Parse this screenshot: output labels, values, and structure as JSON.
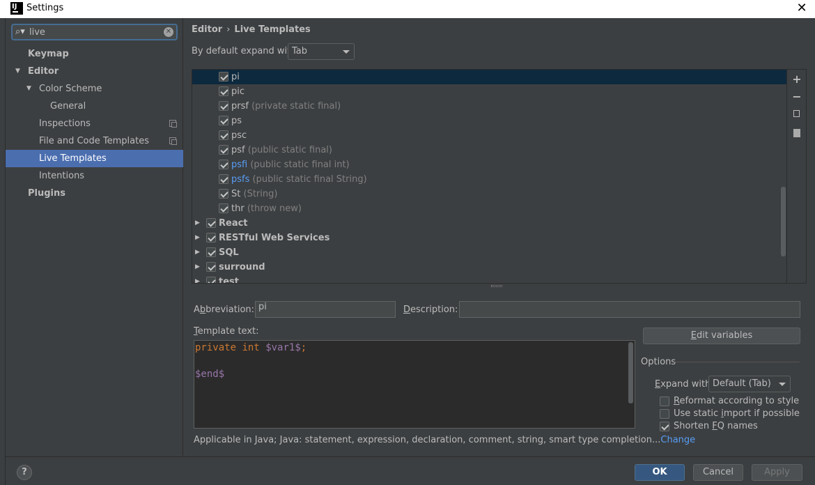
{
  "window": {
    "title": "Settings",
    "icon_text": "IJ",
    "close_glyph": "✕"
  },
  "search": {
    "value": "live",
    "icon": "search-icon",
    "clear_glyph": "✕"
  },
  "sidebar": {
    "items": [
      {
        "label": "Keymap",
        "bold": true,
        "level": 0
      },
      {
        "label": "Editor",
        "bold": true,
        "level": 0,
        "expanded": true
      },
      {
        "label": "Color Scheme",
        "level": 1,
        "expanded": true
      },
      {
        "label": "General",
        "level": 2
      },
      {
        "label": "Inspections",
        "level": 1,
        "copy_icon": true
      },
      {
        "label": "File and Code Templates",
        "level": 1,
        "copy_icon": true
      },
      {
        "label": "Live Templates",
        "level": 1,
        "selected": true
      },
      {
        "label": "Intentions",
        "level": 1
      },
      {
        "label": "Plugins",
        "bold": true,
        "level": 0
      }
    ]
  },
  "breadcrumb": {
    "first": "Editor",
    "separator": "›",
    "second": "Live Templates"
  },
  "expand_default": {
    "label": "By default expand with",
    "value": "Tab"
  },
  "templates": [
    {
      "name": "pi",
      "desc": "",
      "checked": true,
      "selected": true
    },
    {
      "name": "pic",
      "desc": "",
      "checked": true
    },
    {
      "name": "prsf",
      "desc": "(private static final)",
      "checked": true
    },
    {
      "name": "ps",
      "desc": "",
      "checked": true
    },
    {
      "name": "psc",
      "desc": "",
      "checked": true
    },
    {
      "name": "psf",
      "desc": "(public static final)",
      "checked": true
    },
    {
      "name": "psfi",
      "desc": "(public static final int)",
      "checked": true,
      "blue": true
    },
    {
      "name": "psfs",
      "desc": "(public static final String)",
      "checked": true,
      "blue": true
    },
    {
      "name": "St",
      "desc": "(String)",
      "checked": true
    },
    {
      "name": "thr",
      "desc": "(throw new)",
      "checked": true
    }
  ],
  "groups": [
    {
      "name": "React",
      "checked": true
    },
    {
      "name": "RESTful Web Services",
      "checked": true
    },
    {
      "name": "SQL",
      "checked": true
    },
    {
      "name": "surround",
      "checked": true
    },
    {
      "name": "test",
      "checked": true
    }
  ],
  "side_buttons": {
    "add": "+",
    "remove": "−"
  },
  "abbreviation": {
    "label_pre": "A",
    "label_u": "b",
    "label_post": "breviation:",
    "value": "pi"
  },
  "description": {
    "label_pre": "",
    "label_u": "D",
    "label_post": "escription:",
    "value": ""
  },
  "template_text": {
    "label_u": "T",
    "label_post": "emplate text:",
    "kw1": "private",
    "kw2": "int",
    "var": "$var1$",
    "semi": ";",
    "end": "$end$"
  },
  "edit_variables": {
    "label_u": "E",
    "label_post": "dit variables"
  },
  "options": {
    "title": "Options",
    "expand_label_u": "E",
    "expand_label_post": "xpand with",
    "expand_value": "Default (Tab)",
    "reformat": {
      "label_u": "R",
      "label_post": "eformat according to style",
      "checked": false
    },
    "static_import": {
      "label_pre": "Use static ",
      "label_u": "i",
      "label_post": "mport if possible",
      "checked": false
    },
    "shorten_fq": {
      "label_pre": "Shorten ",
      "label_u": "F",
      "label_post": "Q names",
      "checked": true
    }
  },
  "applicable": {
    "text": "Applicable in Java; Java: statement, expression, declaration, comment, string, smart type completion...",
    "link": "Change"
  },
  "footer": {
    "help": "?",
    "ok": "OK",
    "cancel": "Cancel",
    "apply": "Apply"
  }
}
